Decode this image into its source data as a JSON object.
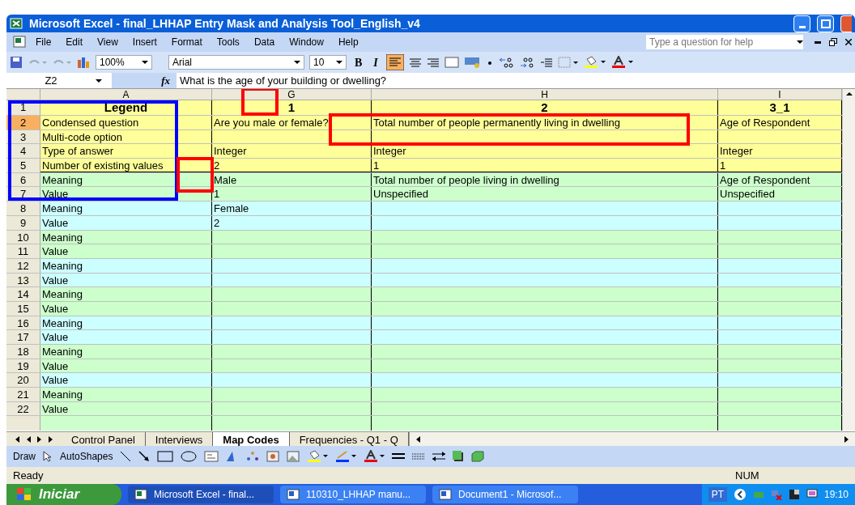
{
  "window": {
    "title": "Microsoft Excel - final_LHHAP Entry Mask and Analysis Tool_English_v4"
  },
  "menu": [
    "File",
    "Edit",
    "View",
    "Insert",
    "Format",
    "Tools",
    "Data",
    "Window",
    "Help"
  ],
  "help_box": {
    "placeholder": "Type a question for help"
  },
  "toolbar": {
    "zoom": "100%",
    "font": "Arial",
    "size": "10",
    "bold": "B",
    "italic": "I"
  },
  "formula_bar": {
    "name_box": "Z2",
    "function_label": "fx",
    "formula": "What is the age of your building or dwelling?"
  },
  "columns": [
    "A",
    "G",
    "H",
    "I"
  ],
  "rows": [
    {
      "number": "1",
      "selected": false,
      "kind": "title",
      "cells": [
        "Legend",
        "1",
        "2",
        "3_1"
      ]
    },
    {
      "number": "2",
      "selected": true,
      "kind": "yellow",
      "cells": [
        "Condensed question",
        "Are you male or female?",
        "Total number of people permanently living in dwelling",
        "Age of Respondent"
      ]
    },
    {
      "number": "3",
      "selected": false,
      "kind": "yellow",
      "cells": [
        "Multi-code option",
        "",
        "",
        ""
      ]
    },
    {
      "number": "4",
      "selected": false,
      "kind": "yellow",
      "cells": [
        "Type of answer",
        "Integer",
        "Integer",
        "Integer"
      ]
    },
    {
      "number": "5",
      "selected": false,
      "kind": "yellow",
      "cells": [
        "Number of existing values",
        "2",
        "1",
        "1"
      ]
    },
    {
      "number": "6",
      "selected": false,
      "kind": "green",
      "cells": [
        "Meaning",
        "Male",
        "Total number of people living in dwelling",
        "Age of Respondent"
      ]
    },
    {
      "number": "7",
      "selected": false,
      "kind": "green",
      "cells": [
        "Value",
        "1",
        "Unspecified",
        "Unspecified"
      ]
    },
    {
      "number": "8",
      "selected": false,
      "kind": "cyan",
      "cells": [
        "Meaning",
        "Female",
        "",
        ""
      ]
    },
    {
      "number": "9",
      "selected": false,
      "kind": "cyan",
      "cells": [
        "Value",
        "2",
        "",
        ""
      ]
    },
    {
      "number": "10",
      "selected": false,
      "kind": "green",
      "cells": [
        "Meaning",
        "",
        "",
        ""
      ]
    },
    {
      "number": "11",
      "selected": false,
      "kind": "green",
      "cells": [
        "Value",
        "",
        "",
        ""
      ]
    },
    {
      "number": "12",
      "selected": false,
      "kind": "cyan",
      "cells": [
        "Meaning",
        "",
        "",
        ""
      ]
    },
    {
      "number": "13",
      "selected": false,
      "kind": "cyan",
      "cells": [
        "Value",
        "",
        "",
        ""
      ]
    },
    {
      "number": "14",
      "selected": false,
      "kind": "green",
      "cells": [
        "Meaning",
        "",
        "",
        ""
      ]
    },
    {
      "number": "15",
      "selected": false,
      "kind": "green",
      "cells": [
        "Value",
        "",
        "",
        ""
      ]
    },
    {
      "number": "16",
      "selected": false,
      "kind": "cyan",
      "cells": [
        "Meaning",
        "",
        "",
        ""
      ]
    },
    {
      "number": "17",
      "selected": false,
      "kind": "cyan",
      "cells": [
        "Value",
        "",
        "",
        ""
      ]
    },
    {
      "number": "18",
      "selected": false,
      "kind": "green",
      "cells": [
        "Meaning",
        "",
        "",
        ""
      ]
    },
    {
      "number": "19",
      "selected": false,
      "kind": "green",
      "cells": [
        "Value",
        "",
        "",
        ""
      ]
    },
    {
      "number": "20",
      "selected": false,
      "kind": "cyan",
      "cells": [
        "Value",
        "",
        "",
        ""
      ]
    },
    {
      "number": "21",
      "selected": false,
      "kind": "green",
      "cells": [
        "Meaning",
        "",
        "",
        ""
      ]
    },
    {
      "number": "22",
      "selected": false,
      "kind": "green",
      "cells": [
        "Value",
        "",
        "",
        ""
      ]
    }
  ],
  "sheet_tabs": [
    {
      "label": "Control Panel",
      "selected": false
    },
    {
      "label": "Interviews",
      "selected": false
    },
    {
      "label": "Map Codes",
      "selected": true
    },
    {
      "label": "Frequencies - Q1 - Q",
      "selected": false
    }
  ],
  "drawing_toolbar": {
    "draw": "Draw",
    "autoshapes": "AutoShapes"
  },
  "status_bar": {
    "status": "Ready",
    "indicator": "NUM"
  },
  "annotations": [
    {
      "color": "#0000ff"
    },
    {
      "color": "#ff0000"
    },
    {
      "color": "#ff0000"
    },
    {
      "color": "#ff0000"
    }
  ],
  "taskbar": {
    "start": "Iniciar",
    "tasks": [
      {
        "label": "Microsoft Excel - final...",
        "selected": true
      },
      {
        "label": "110310_LHHAP manu...",
        "selected": false
      },
      {
        "label": "Document1 - Microsof...",
        "selected": false
      }
    ],
    "language": "PT",
    "clock": "19:10"
  }
}
